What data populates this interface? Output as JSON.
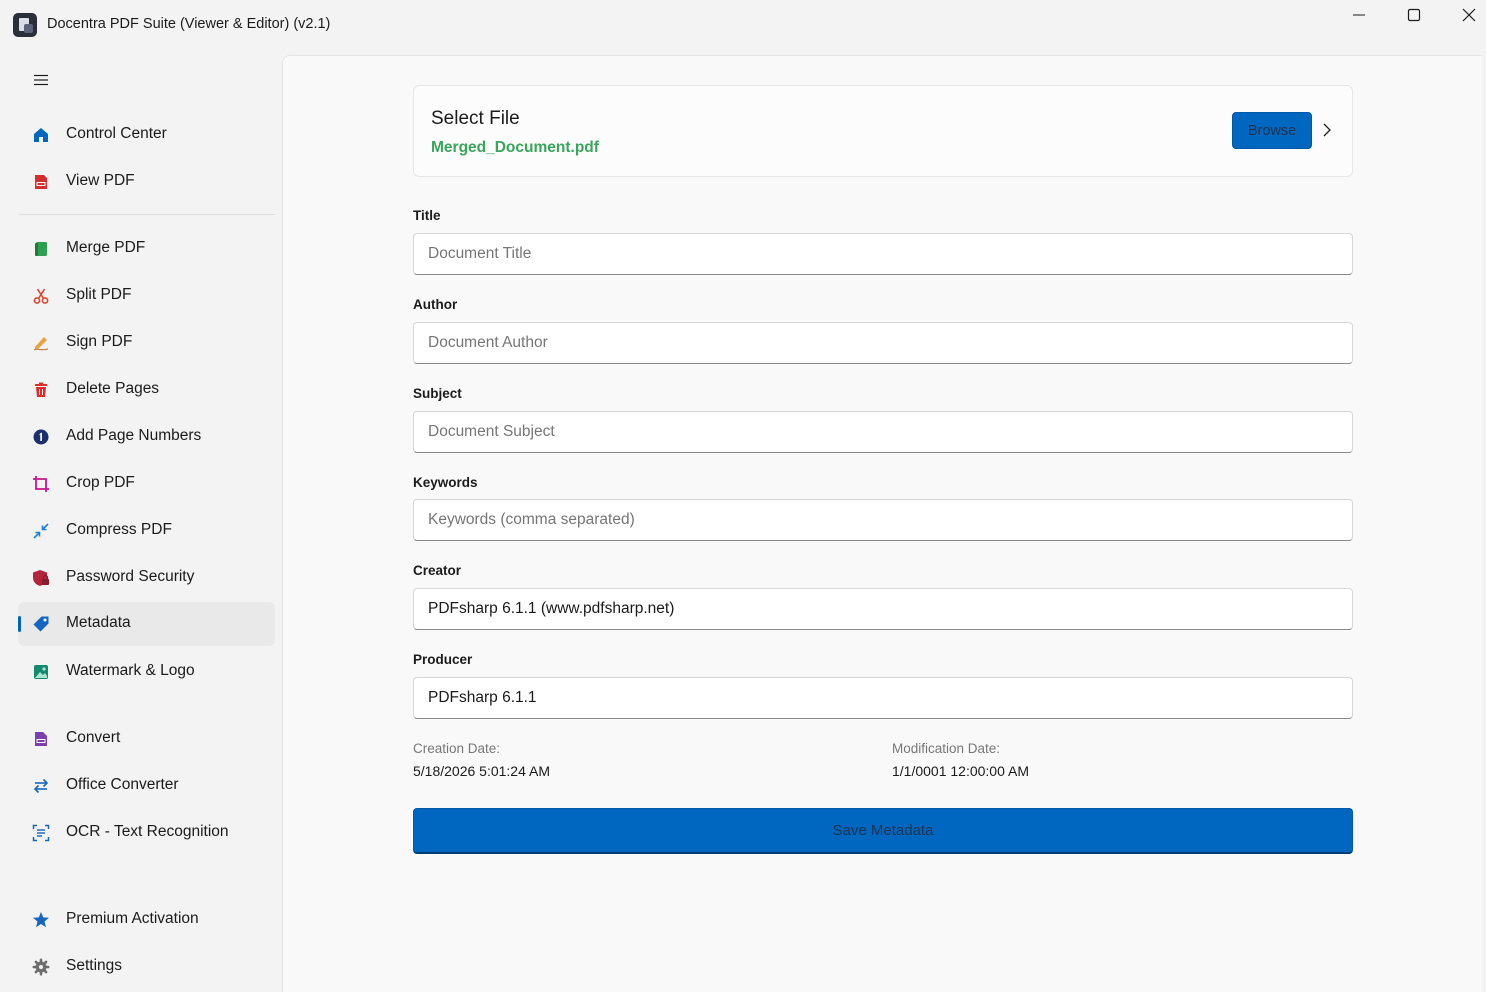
{
  "window": {
    "title": "Docentra PDF Suite (Viewer & Editor)  (v2.1)",
    "controls": [
      "minimize",
      "maximize",
      "close"
    ]
  },
  "sidebar": {
    "menu_icon": "hamburger-icon",
    "items": [
      {
        "label": "Control Center",
        "icon": "home-icon",
        "color": "#0067c0"
      },
      {
        "label": "View PDF",
        "icon": "pdf-file-icon",
        "color": "#d32f2f"
      },
      {
        "label": "Merge PDF",
        "icon": "merge-book-icon",
        "color": "#2e9e4f"
      },
      {
        "label": "Split PDF",
        "icon": "scissors-icon",
        "color": "#e0452f"
      },
      {
        "label": "Sign PDF",
        "icon": "pen-sign-icon",
        "color": "#e8a33a"
      },
      {
        "label": "Delete Pages",
        "icon": "trash-icon",
        "color": "#e02a2a"
      },
      {
        "label": "Add Page Numbers",
        "icon": "number-one-icon",
        "color": "#1a2f6b"
      },
      {
        "label": "Crop PDF",
        "icon": "crop-icon",
        "color": "#c2188f"
      },
      {
        "label": "Compress PDF",
        "icon": "compress-arrows-icon",
        "color": "#1e7fd6"
      },
      {
        "label": "Password Security",
        "icon": "shield-lock-icon",
        "color": "#b2243c"
      },
      {
        "label": "Metadata",
        "icon": "tag-icon",
        "color": "#1466c2",
        "active": true
      },
      {
        "label": "Watermark & Logo",
        "icon": "image-icon",
        "color": "#13896e"
      },
      {
        "label": "Convert",
        "icon": "convert-file-icon",
        "color": "#7b3fb0"
      },
      {
        "label": "Office Converter",
        "icon": "swap-arrows-icon",
        "color": "#1466c2"
      },
      {
        "label": "OCR - Text Recognition",
        "icon": "scan-text-icon",
        "color": "#1466c2"
      },
      {
        "label": "Premium Activation",
        "icon": "star-icon",
        "color": "#1466c2"
      },
      {
        "label": "Settings",
        "icon": "gear-icon",
        "color": "#6e6e6e"
      }
    ]
  },
  "file_card": {
    "heading": "Select File",
    "filename": "Merged_Document.pdf",
    "browse_label": "Browse",
    "accent": "#3aa55d"
  },
  "form": {
    "title": {
      "label": "Title",
      "placeholder": "Document Title",
      "value": ""
    },
    "author": {
      "label": "Author",
      "placeholder": "Document Author",
      "value": ""
    },
    "subject": {
      "label": "Subject",
      "placeholder": "Document Subject",
      "value": ""
    },
    "keywords": {
      "label": "Keywords",
      "placeholder": "Keywords (comma separated)",
      "value": ""
    },
    "creator": {
      "label": "Creator",
      "placeholder": "",
      "value": "PDFsharp 6.1.1 (www.pdfsharp.net)"
    },
    "producer": {
      "label": "Producer",
      "placeholder": "",
      "value": "PDFsharp 6.1.1"
    }
  },
  "dates": {
    "creation_label": "Creation Date:",
    "creation_value": "5/18/2026 5:01:24 AM",
    "modification_label": "Modification Date:",
    "modification_value": "1/1/0001 12:00:00 AM"
  },
  "save_label": "Save Metadata",
  "colors": {
    "accent": "#0067c0",
    "background": "#f3f3f3",
    "content": "#f9f9f9"
  }
}
